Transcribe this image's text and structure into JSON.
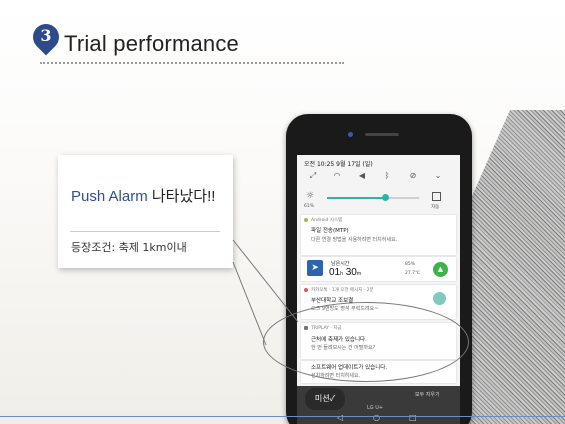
{
  "header": {
    "step_number": "3",
    "title": "Trial performance"
  },
  "callout": {
    "title_en": "Push Alarm",
    "title_ko": " 나타났다!!",
    "condition": "등장조건: 축제 1km이내"
  },
  "phone": {
    "status_time": "오전 10:25  9월 17일 (일)",
    "brightness": {
      "percent_label": "61%",
      "level": 0.61,
      "auto_label": "자동"
    },
    "quick_settings_icons": [
      "screen-rotate-icon",
      "wifi-off-icon",
      "sound-icon",
      "bluetooth-off-icon",
      "location-off-icon",
      "chevron-down-icon"
    ],
    "notifications": [
      {
        "source": "Android 시스템",
        "title": "파일 전송(MTP)",
        "body": "다른 연결 방법을 사용하려면 터치하세요."
      },
      {
        "label": "남은시간",
        "time_h": "01",
        "h_unit": "h",
        "time_m": "30",
        "m_unit": "m",
        "battery": "85%",
        "temp": "27.7℃"
      },
      {
        "source": "카카오톡 · 1개 오전 메시지 · 2분",
        "title": "부산대학교 조보결",
        "body": "오크 9번방도 명석 부릭드려요~"
      },
      {
        "source": "TRIPLAY · 지금",
        "title": "근처에 축제가 있습니다.",
        "body": "한 번 들려보시는 건 어떨까요?"
      },
      {
        "title": "소프트웨어 업데이트가 있습니다.",
        "body": "설치하려면 터치하세요."
      }
    ],
    "bottom": {
      "sticker": "미션✓",
      "brand": "LG U+",
      "clear_all": "모두 지우기"
    }
  }
}
